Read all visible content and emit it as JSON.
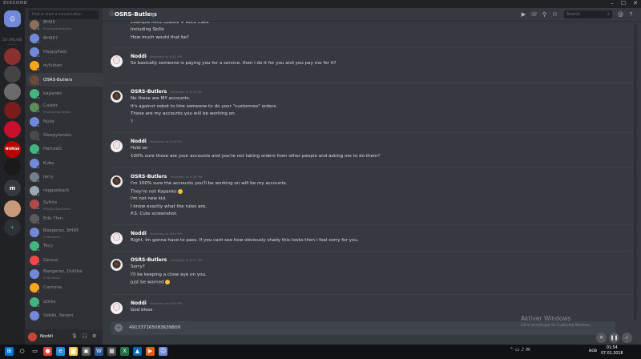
{
  "window": {
    "brand": "DISCORD",
    "controls": [
      "–",
      "☐",
      "✕"
    ]
  },
  "guilds": {
    "online_count": "16 ONLINE",
    "items": [
      {
        "name": "home",
        "icon": "discord-logo-icon",
        "color": "#7289da"
      },
      {
        "name": "server-1",
        "color": "#8b2f2f"
      },
      {
        "name": "server-2",
        "color": "#444"
      },
      {
        "name": "server-3",
        "color": "#6b6b6b"
      },
      {
        "name": "server-4",
        "color": "#7a1c1c"
      },
      {
        "name": "server-5",
        "color": "#c8102e"
      },
      {
        "name": "server-6",
        "label": "NORGE",
        "color": "#b00"
      },
      {
        "name": "server-7",
        "color": "#1a1a1a"
      },
      {
        "name": "server-8",
        "label": "m",
        "color": "#36393f"
      },
      {
        "name": "server-9",
        "color": "#c99a7a"
      }
    ],
    "add_label": "+"
  },
  "sidebar": {
    "search_placeholder": "Find or start a conversation",
    "dms": [
      {
        "name": "BH95",
        "sub": "Playing Bluestacks",
        "color": "#8c6e5a",
        "status": "#43b581"
      },
      {
        "name": "BH95?",
        "color": "#7289da",
        "status": "#747f8d"
      },
      {
        "name": "HappyFeet",
        "color": "#7289da",
        "status": "#747f8d"
      },
      {
        "name": "dyliuban",
        "color": "#faa61a",
        "status": "#747f8d"
      },
      {
        "name": "OSRS-Butlers",
        "color": "#6a4a3a",
        "status": "#747f8d",
        "active": true
      },
      {
        "name": "kapanko",
        "color": "#43b581",
        "status": "#747f8d"
      },
      {
        "name": "Calebr",
        "sub": "Playing Dauntless",
        "color": "#5b8c5a",
        "status": "#43b581"
      },
      {
        "name": "Nuke",
        "color": "#7289da",
        "status": "#747f8d"
      },
      {
        "name": "Sleepylamku",
        "color": "#4a4a4a",
        "status": "#747f8d"
      },
      {
        "name": "HamzeD",
        "color": "#43b581",
        "status": "#747f8d"
      },
      {
        "name": "Kubo",
        "color": "#7289da",
        "status": "#747f8d"
      },
      {
        "name": "Jerry",
        "color": "#747f8d",
        "status": "#747f8d"
      },
      {
        "name": "reggaeback",
        "color": "#99aab5",
        "status": "#747f8d"
      },
      {
        "name": "Syltrix",
        "sub": "Playing Warframe",
        "color": "#b34a4a",
        "status": "#43b581"
      },
      {
        "name": "Erik Thm",
        "color": "#5a5a5a",
        "status": "#747f8d"
      },
      {
        "name": "Baegeraz, BH95",
        "sub": "3 Members",
        "color": "#7289da",
        "status": ""
      },
      {
        "name": "Tocy",
        "color": "#43b581",
        "status": "#747f8d"
      },
      {
        "name": "Genua",
        "color": "#f04747",
        "status": "#747f8d"
      },
      {
        "name": "Baegeraz, Dolliba",
        "sub": "3 Members",
        "color": "#7289da",
        "status": ""
      },
      {
        "name": "Carmnia",
        "color": "#faa61a",
        "status": "#747f8d"
      },
      {
        "name": "sDrks",
        "color": "#43b581",
        "status": "#747f8d"
      },
      {
        "name": "Siddis, Severi",
        "color": "#7289da",
        "status": ""
      }
    ]
  },
  "user_panel": {
    "name": "Noddi",
    "color": "#cc4433"
  },
  "chat": {
    "channel_at": "@",
    "title": "OSRS-Butlers",
    "search_placeholder": "Search",
    "header_icons": [
      "video-call-icon",
      "call-icon",
      "pin-icon",
      "add-member-icon",
      "mention-icon",
      "help-icon"
    ],
    "input_value": "491337165083639809",
    "groups": [
      {
        "author": "",
        "avatar": "",
        "time": "",
        "lines": [
          "Example MM2 Quests + Rock Cake",
          "Including Skills",
          "How much would that be?"
        ]
      },
      {
        "author": "Noddi",
        "avatar": "noddi",
        "time": "Yesterday at 8:12 PM",
        "lines": [
          "So basically someone is paying you for a service, then i do it for you and you pay me for it?"
        ]
      },
      {
        "author": "OSRS-Butlers",
        "avatar": "osrs",
        "time": "Yesterday at 8:14 PM",
        "lines": [
          "No these are MY accounts.",
          "It's against osbot to hire someone to do your \"customres\" orders.",
          "These are my accounts you will be working on.",
          "?"
        ]
      },
      {
        "author": "Noddi",
        "avatar": "noddi",
        "time": "Yesterday at 8:16 PM",
        "lines": [
          "Hold on",
          "100% sure these are your accounts and you're not taking orders from other people and asking me to do them?"
        ]
      },
      {
        "author": "OSRS-Butlers",
        "avatar": "osrs",
        "time": "Yesterday at 8:18 PM",
        "lines": [
          "I'm 100% sure the accounts you'll be working on will be my accounts.",
          "They're not Kapanko",
          "I'm not new kid.",
          "I know exactly what the rules are.",
          "P.S. Cute screenshot."
        ]
      },
      {
        "author": "Noddi",
        "avatar": "noddi",
        "time": "Yesterday at 8:20 PM",
        "lines": [
          "Right. Im gonna have to pass. If you cant see how obviously shady this looks then i feel sorry for you."
        ]
      },
      {
        "author": "OSRS-Butlers",
        "avatar": "osrs",
        "time": "Yesterday at 8:22 PM",
        "lines": [
          "Sorry?",
          "I'll be keeping a close eye on you.",
          "Just be warned"
        ]
      },
      {
        "author": "Noddi",
        "avatar": "noddi",
        "time": "Yesterday at 8:23 PM",
        "lines": [
          "God bless"
        ]
      }
    ]
  },
  "watermark": {
    "title": "Aktiver Windows",
    "subtitle": "Gå til innstillinger for å aktivere Windows."
  },
  "taskbar": {
    "apps": [
      "windows-start-icon",
      "search-icon",
      "task-view-icon",
      "chrome-icon",
      "edge-icon",
      "file-explorer-icon",
      "store-icon",
      "word-icon",
      "calculator-icon",
      "excel-icon",
      "photos-icon",
      "media-icon",
      "discord-icon"
    ],
    "lang": "NOB",
    "time": "01:54",
    "date": "07.01.2018"
  }
}
